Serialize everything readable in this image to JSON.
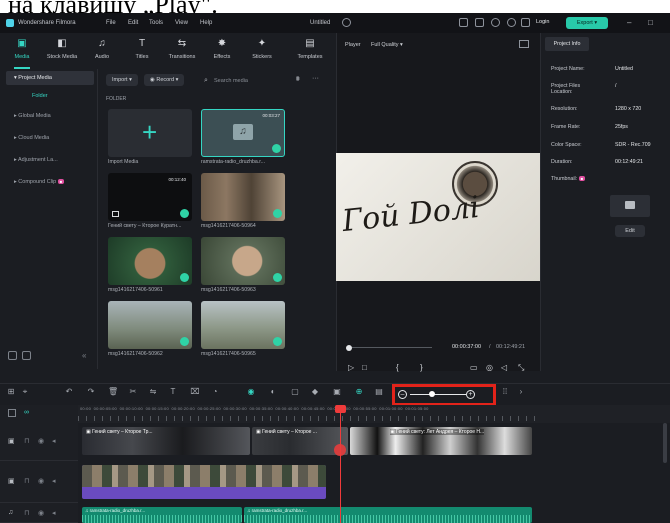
{
  "caption": "на клавишу „Play\".",
  "titlebar": {
    "app_name": "Wondershare Filmora",
    "menu": [
      "File",
      "Edit",
      "Tools",
      "View",
      "Help"
    ],
    "doc_title": "Untitled",
    "login": "Login",
    "export": "Export"
  },
  "media_tabs": [
    {
      "label": "Media",
      "icon": "media-icon",
      "glyph": "▣"
    },
    {
      "label": "Stock Media",
      "icon": "stock-media-icon",
      "glyph": "◧"
    },
    {
      "label": "Audio",
      "icon": "music-note-icon",
      "glyph": "♫"
    },
    {
      "label": "Titles",
      "icon": "text-icon",
      "glyph": "T"
    },
    {
      "label": "Transitions",
      "icon": "transitions-icon",
      "glyph": "⇆"
    },
    {
      "label": "Effects",
      "icon": "effects-icon",
      "glyph": "✸"
    },
    {
      "label": "Stickers",
      "icon": "stickers-icon",
      "glyph": "✦"
    },
    {
      "label": "Templates",
      "icon": "templates-icon",
      "glyph": "▤"
    }
  ],
  "sidebar": {
    "items": [
      {
        "label": "Project Media",
        "selected": true
      },
      {
        "label": "Folder",
        "sub": true
      },
      {
        "label": "Global Media"
      },
      {
        "label": "Cloud Media"
      },
      {
        "label": "Adjustment La..."
      },
      {
        "label": "Compound Clip"
      }
    ]
  },
  "media_toolbar": {
    "import": "Import",
    "record": "Record",
    "search_placeholder": "Search media"
  },
  "folder_label": "FOLDER",
  "media_items": [
    {
      "caption": "Import Media",
      "type": "import"
    },
    {
      "caption": "ramstrata-radio_druzhba.r...",
      "duration": "00:03:27",
      "type": "audio"
    },
    {
      "caption": "Гений свету – Кторое Куратн...",
      "duration": "00:12:40",
      "type": "video-dark"
    },
    {
      "caption": "msg1416217406-50964",
      "type": "video-man"
    },
    {
      "caption": "msg1416217406-50961",
      "type": "video-man2"
    },
    {
      "caption": "msg1416217406-50963",
      "type": "video-man3"
    },
    {
      "caption": "msg1416217406-50962",
      "type": "video-street"
    },
    {
      "caption": "msg1416217406-50965",
      "type": "video-street2"
    }
  ],
  "player": {
    "label": "Player",
    "quality": "Full Quality",
    "current_time": "00:00:37:00",
    "total_time": "00:12:49:21",
    "overlay_text": "Гой Dолі"
  },
  "project_info": {
    "tab": "Project Info",
    "rows": [
      {
        "label": "Project Name:",
        "value": "Untitled"
      },
      {
        "label": "Project Files Location:",
        "value": "/"
      },
      {
        "label": "Resolution:",
        "value": "1280 x 720"
      },
      {
        "label": "Frame Rate:",
        "value": "25fps"
      },
      {
        "label": "Color Space:",
        "value": "SDR - Rec.709"
      },
      {
        "label": "Duration:",
        "value": "00:12:49:21"
      },
      {
        "label": "Thumbnail:",
        "value": ""
      }
    ],
    "edit_button": "Edit"
  },
  "timeline": {
    "ruler_ticks": [
      "00:00",
      "00:00:05:00",
      "00:00:10:00",
      "00:00:15:00",
      "00:00:20:00",
      "00:00:25:00",
      "00:00:30:00",
      "00:00:35:00",
      "00:00:40:00",
      "00:00:45:00",
      "00:00:50:00",
      "00:00:55:00",
      "00:01:00:00",
      "00:01:05:00"
    ],
    "video_clip_title": "Гений свету – Кторое Тр...",
    "video_clip_title2": "Гений свету – Кторое ...",
    "video_clip_title3": "Гений свету: Лет Андрея – Кторое Н...",
    "audio_clip_title": "ramstrata-radio_druzhba.r...",
    "audio_clip_title2": "ramstrata-radio_druzhba.r..."
  },
  "colors": {
    "accent": "#35d6c3",
    "export": "#28c9a9",
    "highlight": "#e2231a",
    "video_track": "#6a4bbf",
    "audio_track": "#1aa88a"
  }
}
